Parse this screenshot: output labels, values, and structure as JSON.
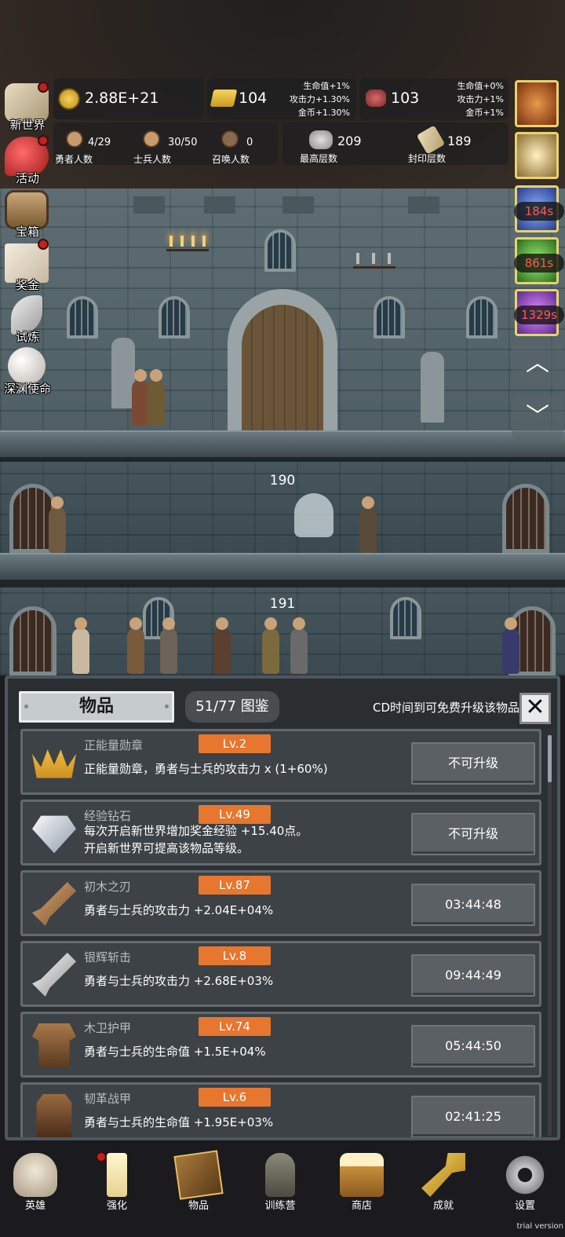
{
  "resources": {
    "gold": "2.88E+21",
    "gold_bar": "104",
    "gold_bar_bonus": [
      "生命值+1%",
      "攻击力+1.30%",
      "金币+1.30%"
    ],
    "meat": "103",
    "meat_bonus": [
      "生命值+0%",
      "攻击力+1%",
      "金币+1%"
    ]
  },
  "stats": {
    "heroes": {
      "value": "4/29",
      "label": "勇者人数"
    },
    "soldiers": {
      "value": "30/50",
      "label": "士兵人数"
    },
    "summons": {
      "value": "0",
      "label": "召唤人数"
    },
    "highest_floor": {
      "value": "209",
      "label": "最高层数"
    },
    "sealed_floor": {
      "value": "189",
      "label": "封印层数"
    }
  },
  "left_menu": [
    {
      "label": "新世界",
      "icon": "map-scroll-icon",
      "dot": true
    },
    {
      "label": "活动",
      "icon": "heart-icon",
      "dot": true
    },
    {
      "label": "宝箱",
      "icon": "treasure-chest-icon",
      "dot": false
    },
    {
      "label": "奖金",
      "icon": "envelope-icon",
      "dot": true
    },
    {
      "label": "试炼",
      "icon": "feather-icon",
      "dot": false
    },
    {
      "label": "深渊使命",
      "icon": "pearl-orb-icon",
      "dot": false
    }
  ],
  "right_buffs": [
    {
      "icon": "apple-icon",
      "timer": ""
    },
    {
      "icon": "candle-icon",
      "timer": ""
    },
    {
      "icon": "buff-blue-icon",
      "timer": "184s"
    },
    {
      "icon": "buff-green-icon",
      "timer": "861s"
    },
    {
      "icon": "buff-purple-icon",
      "timer": "1329s"
    }
  ],
  "floors": {
    "f1": "190",
    "f2": "191"
  },
  "panel": {
    "tab": "物品",
    "collection": "51/77 图鉴",
    "hint": "CD时间到可免费升级该物品",
    "close": "✕",
    "items": [
      {
        "name": "正能量勋章",
        "level": "Lv.2",
        "desc": "正能量勋章，勇者与士兵的攻击力 x (1+60%)",
        "desc2": "",
        "action": "不可升级",
        "icon": "crown-icon"
      },
      {
        "name": "经验钻石",
        "level": "Lv.49",
        "desc": "每次开启新世界增加奖金经验 +15.40点。",
        "desc2": "开启新世界可提高该物品等级。",
        "action": "不可升级",
        "icon": "diamond-icon"
      },
      {
        "name": "初木之刃",
        "level": "Lv.87",
        "desc": "勇者与士兵的攻击力 +2.04E+04%",
        "desc2": "",
        "action": "03:44:48",
        "icon": "wooden-sword-icon"
      },
      {
        "name": "银辉斩击",
        "level": "Lv.8",
        "desc": "勇者与士兵的攻击力 +2.68E+03%",
        "desc2": "",
        "action": "09:44:49",
        "icon": "silver-sword-icon"
      },
      {
        "name": "木卫护甲",
        "level": "Lv.74",
        "desc": "勇者与士兵的生命值 +1.5E+04%",
        "desc2": "",
        "action": "05:44:50",
        "icon": "wooden-armor-icon"
      },
      {
        "name": "韧革战甲",
        "level": "Lv.6",
        "desc": "勇者与士兵的生命值 +1.95E+03%",
        "desc2": "",
        "action": "02:41:25",
        "icon": "leather-armor-icon"
      }
    ]
  },
  "bottom_nav": [
    {
      "label": "英雄",
      "icon": "skull-icon",
      "dot": false
    },
    {
      "label": "强化",
      "icon": "candle-icon",
      "dot": true
    },
    {
      "label": "物品",
      "icon": "book-icon",
      "dot": false
    },
    {
      "label": "训练营",
      "icon": "lantern-icon",
      "dot": false
    },
    {
      "label": "商店",
      "icon": "beer-mug-icon",
      "dot": false
    },
    {
      "label": "成就",
      "icon": "key-icon",
      "dot": false
    },
    {
      "label": "设置",
      "icon": "gear-icon",
      "dot": false
    }
  ],
  "trial_label": "trial version"
}
